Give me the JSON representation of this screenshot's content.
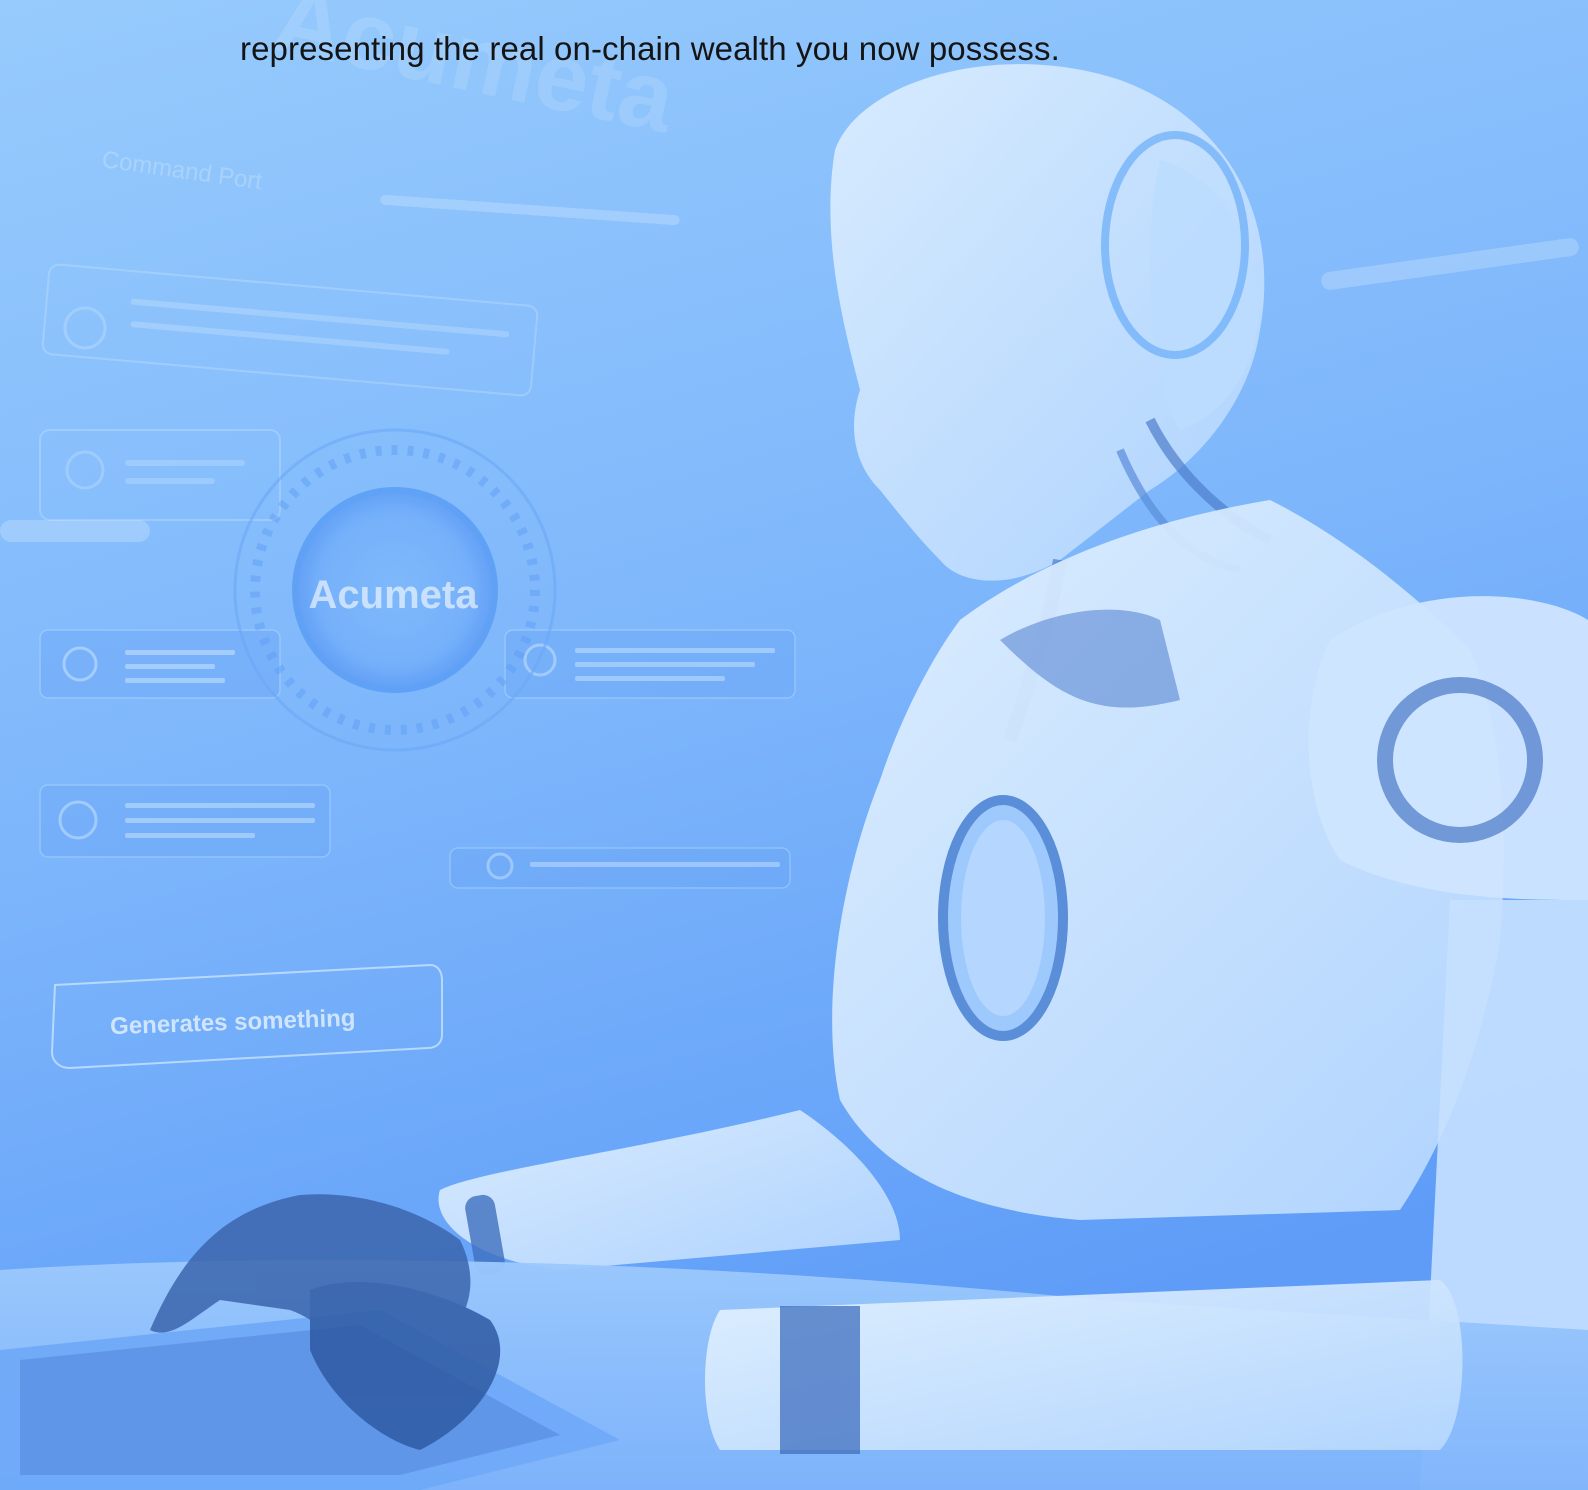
{
  "document": {
    "text_line": "representing the real on-chain wealth you now possess."
  },
  "illustration": {
    "brand_watermark": "Acumeta",
    "panel_title": "Command Port",
    "hub_label": "Acumeta",
    "bottom_button_label": "Generates something"
  },
  "colors": {
    "background_top": "#93c8fc",
    "background_bottom": "#5f9ef9",
    "robot_white": "#d7ecff",
    "robot_dark": "#3f6fbf",
    "text": "#141414"
  }
}
